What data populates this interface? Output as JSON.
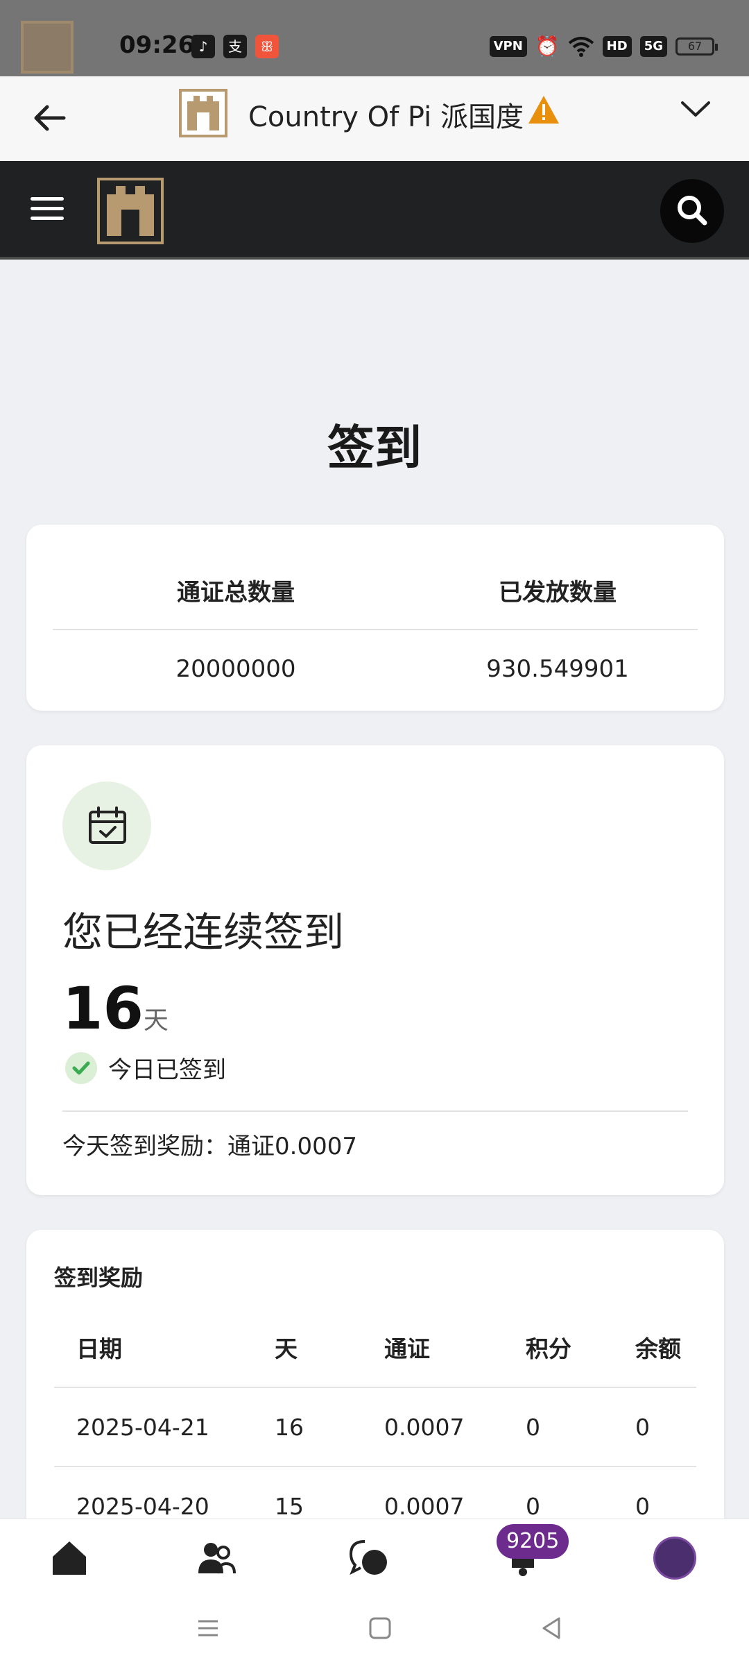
{
  "status_bar": {
    "time": "09:26",
    "notification_glyphs": [
      "♪",
      "支",
      "ꕥ"
    ],
    "vpn_label": "VPN",
    "hd_label": "HD",
    "network_label": "5G",
    "battery": "67"
  },
  "header": {
    "title": "Country Of Pi 派国度"
  },
  "page": {
    "title": "签到"
  },
  "stats": {
    "total_label": "通证总数量",
    "issued_label": "已发放数量",
    "total_value": "20000000",
    "issued_value": "930.549901"
  },
  "checkin": {
    "heading": "您已经连续签到",
    "streak_days": "16",
    "streak_unit": "天",
    "status": "今日已签到",
    "reward_text": "今天签到奖励：通证0.0007"
  },
  "rewards": {
    "title": "签到奖励",
    "columns": [
      "日期",
      "天",
      "通证",
      "积分",
      "余额"
    ],
    "rows": [
      [
        "2025-04-21",
        "16",
        "0.0007",
        "0",
        "0"
      ],
      [
        "2025-04-20",
        "15",
        "0.0007",
        "0",
        "0"
      ]
    ]
  },
  "bottom_nav": {
    "notification_count": "9205",
    "items": [
      "home-icon",
      "users-icon",
      "chat-icon",
      "bell-icon",
      "avatar"
    ]
  },
  "colors": {
    "navbar": "#1f2123",
    "accent_gold": "#b89a70",
    "badge": "#6d2b8e",
    "warning": "#e8900c",
    "success": "#3bab52"
  }
}
